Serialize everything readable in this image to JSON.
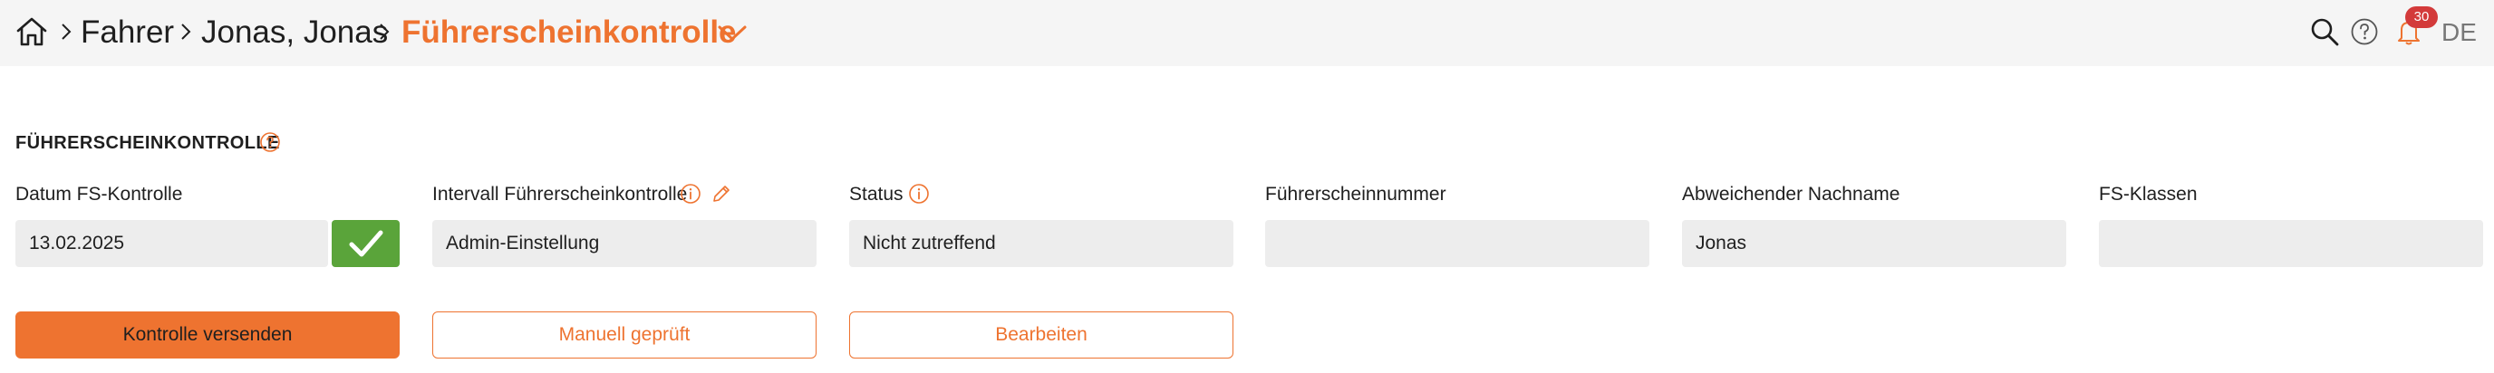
{
  "header": {
    "breadcrumbs": [
      {
        "label": "Fahrer"
      },
      {
        "label": "Jonas, Jonas"
      },
      {
        "label": "Führerscheinkontrolle"
      }
    ],
    "notification_count": "30",
    "language": "DE",
    "accent_color": "#ee7330",
    "icons": [
      "home-icon",
      "search-icon",
      "help-icon",
      "bell-icon"
    ]
  },
  "section": {
    "title": "FÜHRERSCHEINKONTROLLE"
  },
  "fields": [
    {
      "label": "Datum FS-Kontrolle",
      "value": "13.02.2025",
      "verified": true
    },
    {
      "label": "Intervall Führerscheinkontrolle",
      "value": "Admin-Einstellung"
    },
    {
      "label": "Status",
      "value": "Nicht zutreffend"
    },
    {
      "label": "Führerscheinnummer",
      "value": ""
    },
    {
      "label": "Abweichender Nachname",
      "value": "Jonas"
    },
    {
      "label": "FS-Klassen",
      "value": ""
    }
  ],
  "buttons": {
    "send": "Kontrolle versenden",
    "manual": "Manuell geprüft",
    "edit": "Bearbeiten"
  }
}
